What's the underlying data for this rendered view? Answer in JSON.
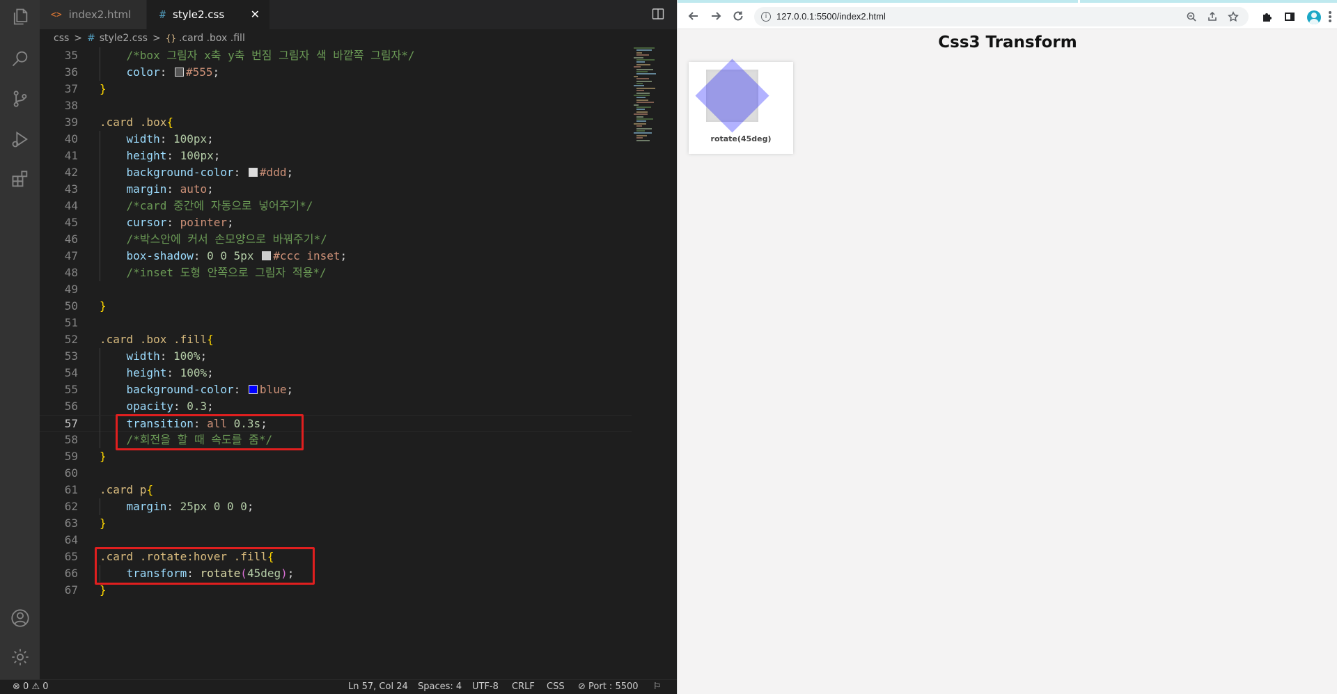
{
  "colors": {
    "editor_bg": "#1e1e1e",
    "activity_bar": "#333333",
    "highlight_border": "#e01f1f",
    "browser_bg": "#f4f3f3"
  },
  "activity_bar": {
    "icons": [
      "explorer-icon",
      "search-icon",
      "source-control-icon",
      "run-debug-icon",
      "extensions-icon",
      "account-icon",
      "settings-gear-icon"
    ]
  },
  "tabs": [
    {
      "icon": "<>",
      "label": "index2.html",
      "active": false
    },
    {
      "icon": "#",
      "label": "style2.css",
      "active": true,
      "close": "✕"
    }
  ],
  "breadcrumb": {
    "folder": "css",
    "hash": "#",
    "file": "style2.css",
    "symbol_icon": "{}",
    "symbol": ".card .box .fill",
    "separator": ">"
  },
  "editor": {
    "current_line": 57,
    "lines": [
      {
        "n": "35",
        "tokens": [
          {
            "c": "t-cmt",
            "t": "    /*box 그림자 x축 y축 번짐 그림자 색 바깥쪽 그림자*/"
          }
        ]
      },
      {
        "n": "36",
        "tokens": [
          {
            "c": "t-prop",
            "t": "    color"
          },
          {
            "c": "t-punc",
            "t": ": "
          },
          {
            "s": "#555555"
          },
          {
            "c": "t-kw",
            "t": "#555"
          },
          {
            "c": "t-punc",
            "t": ";"
          }
        ]
      },
      {
        "n": "37",
        "tokens": [
          {
            "c": "t-brace",
            "t": "}"
          }
        ]
      },
      {
        "n": "38",
        "tokens": []
      },
      {
        "n": "39",
        "tokens": [
          {
            "c": "t-sel",
            "t": ".card .box"
          },
          {
            "c": "t-brace",
            "t": "{"
          }
        ]
      },
      {
        "n": "40",
        "tokens": [
          {
            "c": "t-prop",
            "t": "    width"
          },
          {
            "c": "t-punc",
            "t": ": "
          },
          {
            "c": "t-num",
            "t": "100px"
          },
          {
            "c": "t-punc",
            "t": ";"
          }
        ]
      },
      {
        "n": "41",
        "tokens": [
          {
            "c": "t-prop",
            "t": "    height"
          },
          {
            "c": "t-punc",
            "t": ": "
          },
          {
            "c": "t-num",
            "t": "100px"
          },
          {
            "c": "t-punc",
            "t": ";"
          }
        ]
      },
      {
        "n": "42",
        "tokens": [
          {
            "c": "t-prop",
            "t": "    background-color"
          },
          {
            "c": "t-punc",
            "t": ": "
          },
          {
            "s": "#dddddd"
          },
          {
            "c": "t-kw",
            "t": "#ddd"
          },
          {
            "c": "t-punc",
            "t": ";"
          }
        ]
      },
      {
        "n": "43",
        "tokens": [
          {
            "c": "t-prop",
            "t": "    margin"
          },
          {
            "c": "t-punc",
            "t": ": "
          },
          {
            "c": "t-kw",
            "t": "auto"
          },
          {
            "c": "t-punc",
            "t": ";"
          }
        ]
      },
      {
        "n": "44",
        "tokens": [
          {
            "c": "t-cmt",
            "t": "    /*card 중간에 자동으로 넣어주기*/"
          }
        ]
      },
      {
        "n": "45",
        "tokens": [
          {
            "c": "t-prop",
            "t": "    cursor"
          },
          {
            "c": "t-punc",
            "t": ": "
          },
          {
            "c": "t-kw",
            "t": "pointer"
          },
          {
            "c": "t-punc",
            "t": ";"
          }
        ]
      },
      {
        "n": "46",
        "tokens": [
          {
            "c": "t-cmt",
            "t": "    /*박스안에 커서 손모양으로 바꿔주기*/"
          }
        ]
      },
      {
        "n": "47",
        "tokens": [
          {
            "c": "t-prop",
            "t": "    box-shadow"
          },
          {
            "c": "t-punc",
            "t": ": "
          },
          {
            "c": "t-num",
            "t": "0 0 5px "
          },
          {
            "s": "#cccccc"
          },
          {
            "c": "t-kw",
            "t": "#ccc inset"
          },
          {
            "c": "t-punc",
            "t": ";"
          }
        ]
      },
      {
        "n": "48",
        "tokens": [
          {
            "c": "t-cmt",
            "t": "    /*inset 도형 안쪽으로 그림자 적용*/"
          }
        ]
      },
      {
        "n": "49",
        "tokens": []
      },
      {
        "n": "50",
        "tokens": [
          {
            "c": "t-brace",
            "t": "}"
          }
        ]
      },
      {
        "n": "51",
        "tokens": []
      },
      {
        "n": "52",
        "tokens": [
          {
            "c": "t-sel",
            "t": ".card .box .fill"
          },
          {
            "c": "t-brace",
            "t": "{"
          }
        ]
      },
      {
        "n": "53",
        "tokens": [
          {
            "c": "t-prop",
            "t": "    width"
          },
          {
            "c": "t-punc",
            "t": ": "
          },
          {
            "c": "t-num",
            "t": "100%"
          },
          {
            "c": "t-punc",
            "t": ";"
          }
        ]
      },
      {
        "n": "54",
        "tokens": [
          {
            "c": "t-prop",
            "t": "    height"
          },
          {
            "c": "t-punc",
            "t": ": "
          },
          {
            "c": "t-num",
            "t": "100%"
          },
          {
            "c": "t-punc",
            "t": ";"
          }
        ]
      },
      {
        "n": "55",
        "tokens": [
          {
            "c": "t-prop",
            "t": "    background-color"
          },
          {
            "c": "t-punc",
            "t": ": "
          },
          {
            "s": "#0000ff"
          },
          {
            "c": "t-kw",
            "t": "blue"
          },
          {
            "c": "t-punc",
            "t": ";"
          }
        ]
      },
      {
        "n": "56",
        "tokens": [
          {
            "c": "t-prop",
            "t": "    opacity"
          },
          {
            "c": "t-punc",
            "t": ": "
          },
          {
            "c": "t-num",
            "t": "0.3"
          },
          {
            "c": "t-punc",
            "t": ";"
          }
        ]
      },
      {
        "n": "57",
        "tokens": [
          {
            "c": "t-prop",
            "t": "    transition"
          },
          {
            "c": "t-punc",
            "t": ": "
          },
          {
            "c": "t-kw",
            "t": "all "
          },
          {
            "c": "t-num",
            "t": "0.3s"
          },
          {
            "c": "t-punc",
            "t": ";"
          }
        ]
      },
      {
        "n": "58",
        "tokens": [
          {
            "c": "t-cmt",
            "t": "    /*회전을 할 때 속도를 줌*/"
          }
        ]
      },
      {
        "n": "59",
        "tokens": [
          {
            "c": "t-brace",
            "t": "}"
          }
        ]
      },
      {
        "n": "60",
        "tokens": []
      },
      {
        "n": "61",
        "tokens": [
          {
            "c": "t-sel",
            "t": ".card p"
          },
          {
            "c": "t-brace",
            "t": "{"
          }
        ]
      },
      {
        "n": "62",
        "tokens": [
          {
            "c": "t-prop",
            "t": "    margin"
          },
          {
            "c": "t-punc",
            "t": ": "
          },
          {
            "c": "t-num",
            "t": "25px 0 0 0"
          },
          {
            "c": "t-punc",
            "t": ";"
          }
        ]
      },
      {
        "n": "63",
        "tokens": [
          {
            "c": "t-brace",
            "t": "}"
          }
        ]
      },
      {
        "n": "64",
        "tokens": []
      },
      {
        "n": "65",
        "tokens": [
          {
            "c": "t-sel",
            "t": ".card .rotate:hover .fill"
          },
          {
            "c": "t-brace",
            "t": "{"
          }
        ]
      },
      {
        "n": "66",
        "tokens": [
          {
            "c": "t-prop",
            "t": "    transform"
          },
          {
            "c": "t-punc",
            "t": ": "
          },
          {
            "c": "t-fn",
            "t": "rotate"
          },
          {
            "c": "t-paren",
            "t": "("
          },
          {
            "c": "t-num",
            "t": "45deg"
          },
          {
            "c": "t-paren",
            "t": ")"
          },
          {
            "c": "t-punc",
            "t": ";"
          }
        ]
      },
      {
        "n": "67",
        "tokens": [
          {
            "c": "t-brace",
            "t": "}"
          }
        ]
      }
    ]
  },
  "status_bar": {
    "errors": "0",
    "warnings": "0",
    "position": "Ln 57, Col 24",
    "spaces": "Spaces: 4",
    "encoding": "UTF-8",
    "eol": "CRLF",
    "language": "CSS",
    "port": "Port : 5500"
  },
  "browser": {
    "url": "127.0.0.1:5500/index2.html",
    "page_title": "Css3 Transform",
    "card_caption": "rotate(45deg)"
  }
}
